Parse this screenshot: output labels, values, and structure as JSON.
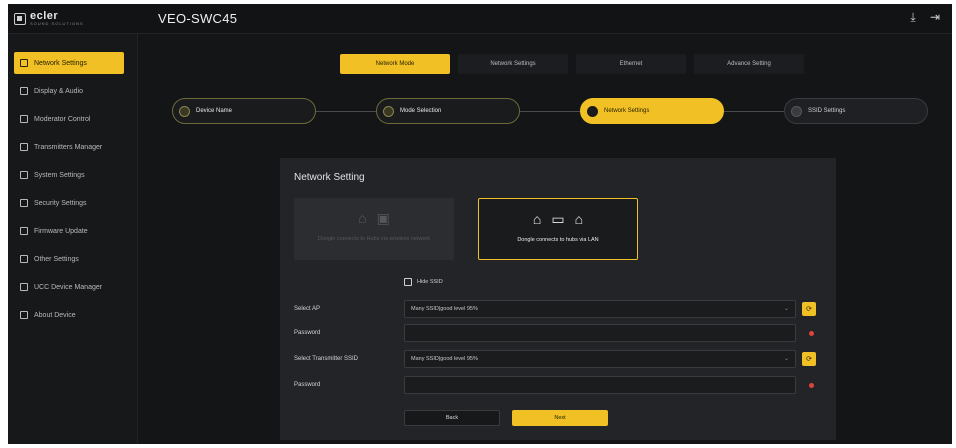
{
  "app": {
    "logo": "ecler",
    "logo_sub": "SOUND SOLUTIONS",
    "device_name": "VEO-SWC45"
  },
  "colors": {
    "accent": "#f0c024",
    "background": "#141517",
    "error": "#e0433a"
  },
  "header_icons": [
    "download-icon",
    "logout-icon"
  ],
  "sidebar": {
    "items": [
      {
        "label": "Network Settings",
        "icon": "network-icon",
        "active": true
      },
      {
        "label": "Display & Audio",
        "icon": "display-icon"
      },
      {
        "label": "Moderator Control",
        "icon": "moderator-icon"
      },
      {
        "label": "Transmitters Manager",
        "icon": "transmitter-icon"
      },
      {
        "label": "System Settings",
        "icon": "gear-icon"
      },
      {
        "label": "Security Settings",
        "icon": "lock-icon"
      },
      {
        "label": "Firmware Update",
        "icon": "update-icon"
      },
      {
        "label": "Other Settings",
        "icon": "sliders-icon"
      },
      {
        "label": "UCC Device Manager",
        "icon": "device-icon"
      },
      {
        "label": "About Device",
        "icon": "info-icon"
      }
    ]
  },
  "mode_tabs": [
    {
      "label": "Network Mode",
      "active": true
    },
    {
      "label": "Network Settings"
    },
    {
      "label": "Ethernet"
    },
    {
      "label": "Advance Setting"
    }
  ],
  "steps": [
    {
      "label": "Device Name",
      "state": "done"
    },
    {
      "label": "Mode Selection",
      "state": "done"
    },
    {
      "label": "Network Settings",
      "state": "current"
    },
    {
      "label": "SSID Settings",
      "state": "pending"
    }
  ],
  "panel": {
    "title": "Network Setting",
    "option_off_text": "Dongle connects to Hubs via wireless network",
    "option_on_text": "Dongle connects to hubs via LAN",
    "hide_label": "Hide SSID",
    "fields": [
      {
        "label": "Select AP",
        "value": "Many SSID|good level 95%"
      },
      {
        "label": "Password",
        "value": ""
      },
      {
        "label": "Select Transmitter SSID",
        "value": "Many SSID|good level 95%"
      },
      {
        "label": "Password",
        "value": ""
      }
    ],
    "back_label": "Back",
    "next_label": "Next"
  }
}
